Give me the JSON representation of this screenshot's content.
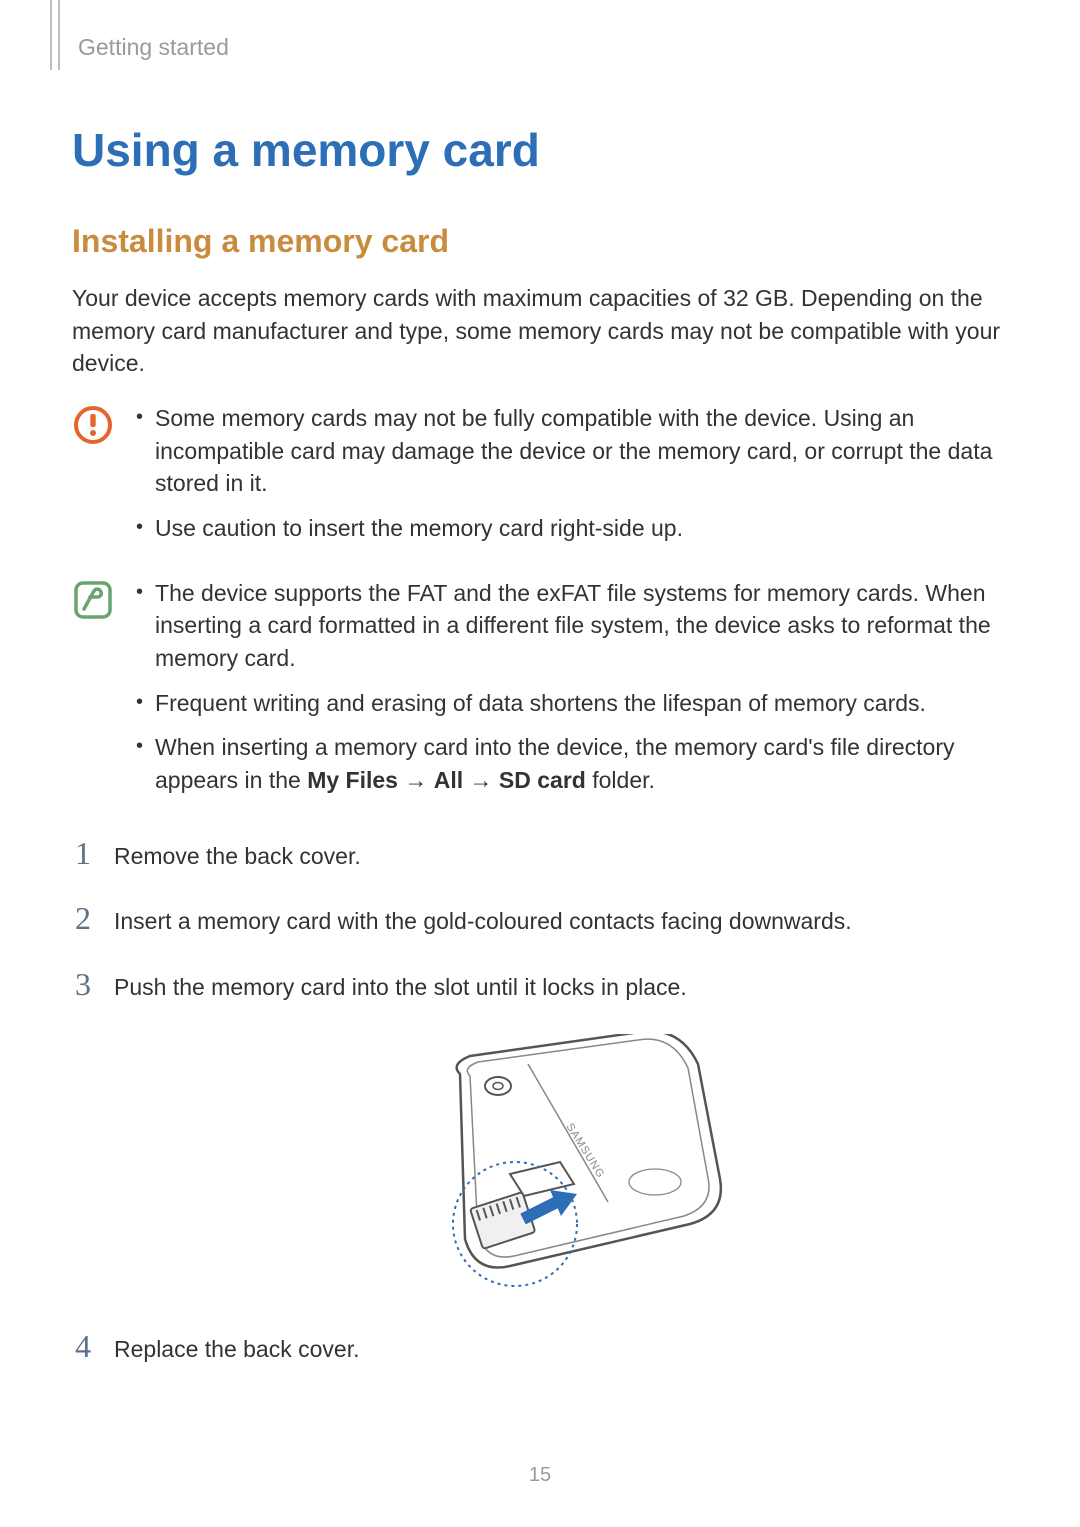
{
  "breadcrumb": "Getting started",
  "h1": "Using a memory card",
  "h2": "Installing a memory card",
  "intro": "Your device accepts memory cards with maximum capacities of 32 GB. Depending on the memory card manufacturer and type, some memory cards may not be compatible with your device.",
  "caution": {
    "items": [
      "Some memory cards may not be fully compatible with the device. Using an incompatible card may damage the device or the memory card, or corrupt the data stored in it.",
      "Use caution to insert the memory card right-side up."
    ]
  },
  "note": {
    "items_pre": [
      "The device supports the FAT and the exFAT file systems for memory cards. When inserting a card formatted in a different file system, the device asks to reformat the memory card.",
      "Frequent writing and erasing of data shortens the lifespan of memory cards."
    ],
    "item3_a": "When inserting a memory card into the device, the memory card's file directory appears in the ",
    "item3_b1": "My Files",
    "item3_arrow1": " → ",
    "item3_b2": "All",
    "item3_arrow2": " → ",
    "item3_b3": "SD card",
    "item3_c": " folder."
  },
  "steps": [
    {
      "num": "1",
      "text": "Remove the back cover."
    },
    {
      "num": "2",
      "text": "Insert a memory card with the gold-coloured contacts facing downwards."
    },
    {
      "num": "3",
      "text": "Push the memory card into the slot until it locks in place."
    },
    {
      "num": "4",
      "text": "Replace the back cover."
    }
  ],
  "page_num": "15",
  "diagram_label": "SAMSUNG"
}
